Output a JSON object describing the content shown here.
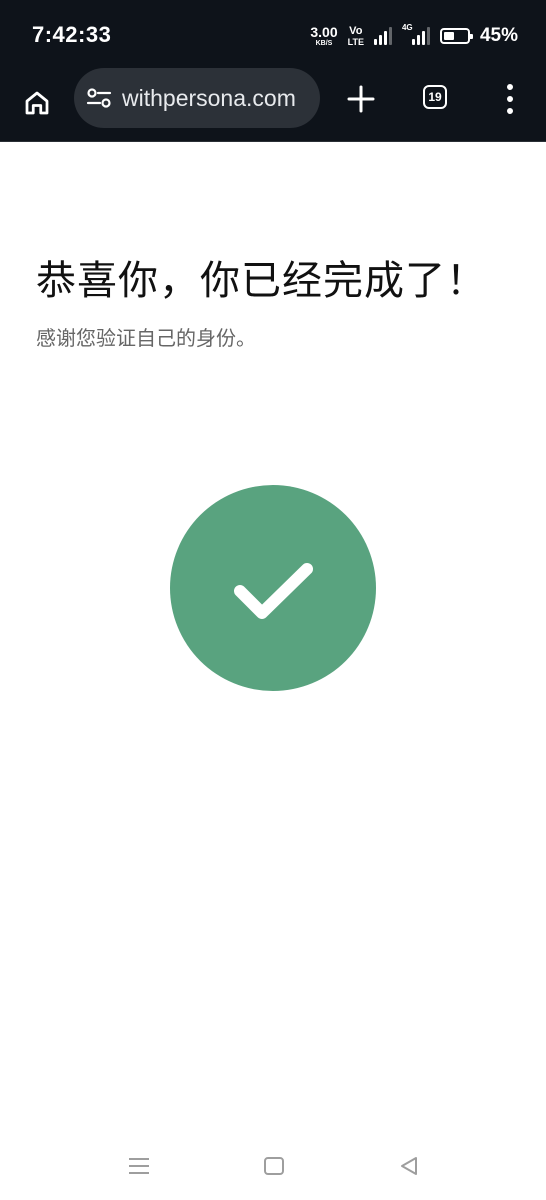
{
  "status_bar": {
    "time": "7:42:33",
    "net_speed_value": "3.00",
    "net_speed_unit": "KB/S",
    "volte_top": "Vo",
    "volte_bottom": "LTE",
    "network_type": "4G",
    "battery_percent": "45%",
    "battery_level": 0.45
  },
  "browser": {
    "url": "withpersona.com",
    "tab_count": "19",
    "icons": {
      "home": "home-icon",
      "site_settings": "tune-icon",
      "new_tab": "plus-icon",
      "menu": "more-vert-icon"
    }
  },
  "page": {
    "title": "恭喜你，你已经完成了！",
    "subtitle": "感谢您验证自己的身份。",
    "success_icon": "checkmark-icon",
    "success_color": "#59a37f"
  },
  "nav_bar": {
    "icons": {
      "recents": "menu-lines-icon",
      "home": "square-icon",
      "back": "triangle-back-icon"
    }
  }
}
